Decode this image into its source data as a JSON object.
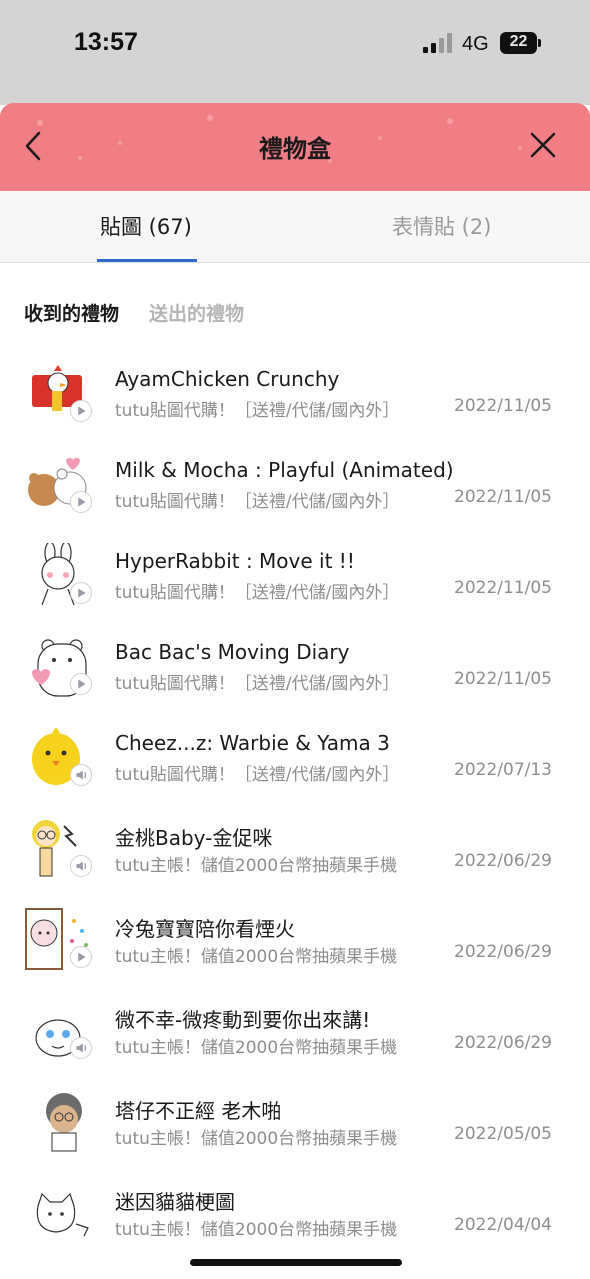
{
  "status_bar": {
    "time": "13:57",
    "network": "4G",
    "battery": "22"
  },
  "header": {
    "title": "禮物盒",
    "back_icon": "chevron-left-icon",
    "close_icon": "close-icon"
  },
  "tabs": [
    {
      "label": "貼圖 (67)",
      "active": true
    },
    {
      "label": "表情貼 (2)",
      "active": false
    }
  ],
  "subtabs": {
    "received": "收到的禮物",
    "sent": "送出的禮物"
  },
  "items": [
    {
      "title": "AyamChicken Crunchy",
      "sender": "tutu貼圖代購！［送禮/代儲/國內外］",
      "date": "2022/11/05",
      "icon": "chicken-sticker-icon",
      "badge": "play-icon"
    },
    {
      "title": "Milk & Mocha : Playful (Animated)",
      "sender": "tutu貼圖代購！［送禮/代儲/國內外］",
      "date": "2022/11/05",
      "icon": "bears-sticker-icon",
      "badge": "play-icon"
    },
    {
      "title": "HyperRabbit : Move it !!",
      "sender": "tutu貼圖代購！［送禮/代儲/國內外］",
      "date": "2022/11/05",
      "icon": "rabbit-sticker-icon",
      "badge": "play-icon"
    },
    {
      "title": "Bac Bac's Moving Diary",
      "sender": "tutu貼圖代購！［送禮/代儲/國內外］",
      "date": "2022/11/05",
      "icon": "polar-bear-sticker-icon",
      "badge": "play-icon"
    },
    {
      "title": "Cheez...z: Warbie & Yama 3",
      "sender": "tutu貼圖代購！［送禮/代儲/國內外］",
      "date": "2022/07/13",
      "icon": "chick-sticker-icon",
      "badge": "sound-icon"
    },
    {
      "title": "金桃Baby-金促咪",
      "sender": "tutu主帳！儲值2000台幣抽蘋果手機",
      "date": "2022/06/29",
      "icon": "girl-sticker-icon",
      "badge": "sound-icon"
    },
    {
      "title": "冷兔寶寶陪你看煙火",
      "sender": "tutu主帳！儲值2000台幣抽蘋果手機",
      "date": "2022/06/29",
      "icon": "bunny-window-sticker-icon",
      "badge": "play-icon"
    },
    {
      "title": "微不幸-微疼動到要你出來講!",
      "sender": "tutu主帳！儲值2000台幣抽蘋果手機",
      "date": "2022/06/29",
      "icon": "creature-sticker-icon",
      "badge": "sound-icon"
    },
    {
      "title": "塔仔不正經 老木啪",
      "sender": "tutu主帳！儲值2000台幣抽蘋果手機",
      "date": "2022/05/05",
      "icon": "lady-sticker-icon",
      "badge": "none"
    },
    {
      "title": "迷因貓貓梗圖",
      "sender": "tutu主帳！儲值2000台幣抽蘋果手機",
      "date": "2022/04/04",
      "icon": "cat-sticker-icon",
      "badge": "none"
    }
  ],
  "colors": {
    "header_pink": "#f17d85",
    "tab_accent": "#2f6cc9"
  }
}
